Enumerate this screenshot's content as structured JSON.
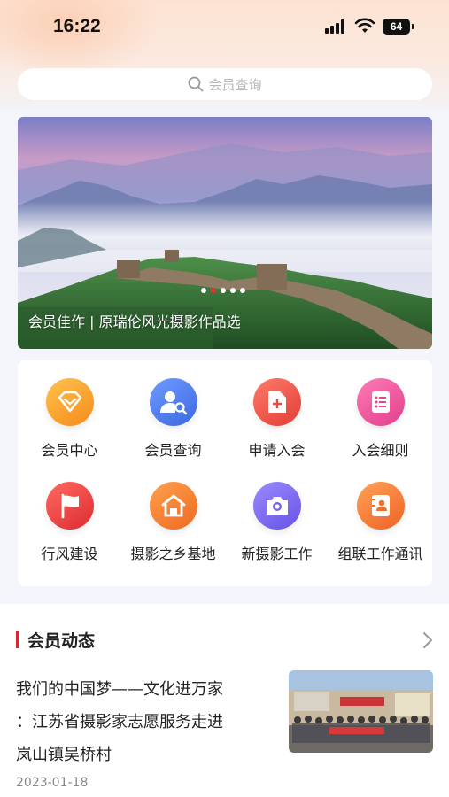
{
  "status": {
    "time": "16:22",
    "battery": "64"
  },
  "search": {
    "placeholder": "会员查询"
  },
  "banner": {
    "caption": "会员佳作 | 原瑞伦风光摄影作品选",
    "dot_count": 5,
    "active_dot": 1
  },
  "menu": {
    "items": [
      {
        "label": "会员中心",
        "icon": "heart-diamond-icon",
        "color": "#f7a42a"
      },
      {
        "label": "会员查询",
        "icon": "user-search-icon",
        "color": "#4f7ef0"
      },
      {
        "label": "申请入会",
        "icon": "add-document-icon",
        "color": "#ef5b4d"
      },
      {
        "label": "入会细则",
        "icon": "list-document-icon",
        "color": "#f0579d"
      },
      {
        "label": "行风建设",
        "icon": "flag-icon",
        "color": "#ee4142"
      },
      {
        "label": "摄影之乡基地",
        "icon": "home-icon",
        "color": "#f47d30"
      },
      {
        "label": "新摄影工作",
        "icon": "camera-icon",
        "color": "#7a67ee"
      },
      {
        "label": "组联工作通讯",
        "icon": "contact-book-icon",
        "color": "#f5782f"
      }
    ]
  },
  "news": {
    "section_title": "会员动态",
    "items": [
      {
        "title": "我们的中国梦——文化进万家：江苏省摄影家志愿服务走进岚山镇吴桥村",
        "title_lines": [
          "我们的中国梦——文化进万家",
          "：江苏省摄影家志愿服务走进",
          "岚山镇吴桥村"
        ],
        "date": "2023-01-18"
      }
    ]
  }
}
